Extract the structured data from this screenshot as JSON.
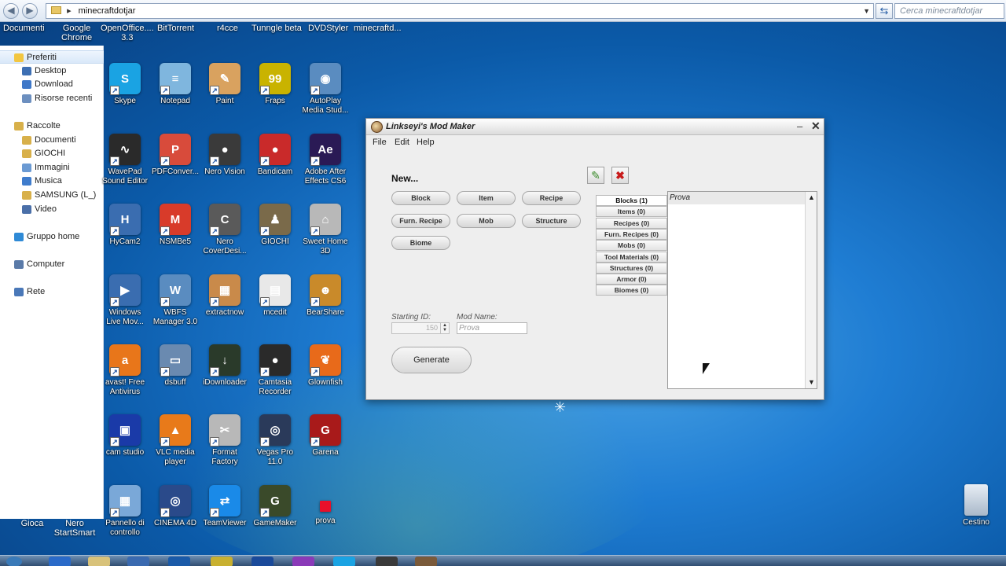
{
  "explorer": {
    "address": "minecraftdotjar",
    "search_placeholder": "Cerca minecraftdotjar",
    "favorites_bar": [
      {
        "label": "Documenti"
      },
      {
        "label": "Google\nChrome"
      },
      {
        "label": "OpenOffice....\n3.3"
      },
      {
        "label": "BitTorrent"
      },
      {
        "label": "r4cce"
      },
      {
        "label": "Tunngle beta"
      },
      {
        "label": "DVDStyler"
      },
      {
        "label": "minecraftd..."
      }
    ],
    "nav": [
      {
        "label": "Preferiti",
        "icon": "star-icon",
        "color": "#f2c641"
      },
      {
        "label": "Desktop",
        "icon": "desktop-icon",
        "color": "#3d6fb3"
      },
      {
        "label": "Download",
        "icon": "download-folder-icon",
        "color": "#3f78c8"
      },
      {
        "label": "Risorse recenti",
        "icon": "recent-places-icon",
        "color": "#6c8fbf"
      },
      {
        "label": "Raccolte",
        "icon": "libraries-icon",
        "color": "#d8b04a"
      },
      {
        "label": "Documenti",
        "icon": "documents-icon",
        "color": "#d8b04a"
      },
      {
        "label": "GIOCHI",
        "icon": "folder-icon",
        "color": "#d8b04a"
      },
      {
        "label": "Immagini",
        "icon": "pictures-icon",
        "color": "#6b9ad3"
      },
      {
        "label": "Musica",
        "icon": "music-icon",
        "color": "#3f7ccc"
      },
      {
        "label": "SAMSUNG (L_)",
        "icon": "folder-icon",
        "color": "#d8b04a"
      },
      {
        "label": "Video",
        "icon": "video-icon",
        "color": "#4a6fa8"
      },
      {
        "label": "Gruppo home",
        "icon": "homegroup-icon",
        "color": "#2f8ad6"
      },
      {
        "label": "Computer",
        "icon": "computer-icon",
        "color": "#5a7aa8"
      },
      {
        "label": "Rete",
        "icon": "network-icon",
        "color": "#4a78b8"
      }
    ],
    "bottom_items": [
      {
        "label": "Gioca"
      },
      {
        "label": "Nero\nStartSmart"
      }
    ]
  },
  "desktop": {
    "icons": [
      {
        "label": "Skype",
        "icon": "skype-icon",
        "color": "#1aa3e3",
        "glyph": "S"
      },
      {
        "label": "Notepad",
        "icon": "notepad-icon",
        "color": "#7fb6de",
        "glyph": "≡"
      },
      {
        "label": "Paint",
        "icon": "paint-icon",
        "color": "#d9a25f",
        "glyph": "✎"
      },
      {
        "label": "Fraps",
        "icon": "fraps-icon",
        "color": "#c9b300",
        "glyph": "99"
      },
      {
        "label": "AutoPlay\nMedia Stud...",
        "icon": "autoplay-icon",
        "color": "#5a8cc0",
        "glyph": "◉"
      },
      {
        "label": "WavePad\nSound Editor",
        "icon": "wavepad-icon",
        "color": "#2a2a2a",
        "glyph": "∿"
      },
      {
        "label": "PDFConver...",
        "icon": "pdf-icon",
        "color": "#d84b3b",
        "glyph": "P"
      },
      {
        "label": "Nero Vision",
        "icon": "nero-vision-icon",
        "color": "#3a3a3a",
        "glyph": "●"
      },
      {
        "label": "Bandicam",
        "icon": "bandicam-icon",
        "color": "#c92a2a",
        "glyph": "●"
      },
      {
        "label": "Adobe After\nEffects CS6",
        "icon": "after-effects-icon",
        "color": "#2a1a55",
        "glyph": "Ae"
      },
      {
        "label": "HyCam2",
        "icon": "hycam-icon",
        "color": "#3a6db0",
        "glyph": "H"
      },
      {
        "label": "NSMBe5",
        "icon": "nsmbe-icon",
        "color": "#d83b2a",
        "glyph": "M"
      },
      {
        "label": "Nero\nCoverDesi...",
        "icon": "nero-cover-icon",
        "color": "#5a5a5a",
        "glyph": "C"
      },
      {
        "label": "GIOCHI",
        "icon": "games-icon",
        "color": "#7a6a4a",
        "glyph": "♟"
      },
      {
        "label": "Sweet Home\n3D",
        "icon": "sweet-home-icon",
        "color": "#b8b8b8",
        "glyph": "⌂"
      },
      {
        "label": "Windows\nLive Mov...",
        "icon": "live-movie-icon",
        "color": "#3a6db0",
        "glyph": "▶"
      },
      {
        "label": "WBFS\nManager 3.0",
        "icon": "wbfs-icon",
        "color": "#5a8cc0",
        "glyph": "W"
      },
      {
        "label": "extractnow",
        "icon": "extractnow-icon",
        "color": "#c98a4a",
        "glyph": "▦"
      },
      {
        "label": "mcedit",
        "icon": "mcedit-icon",
        "color": "#e8e8e8",
        "glyph": "▤"
      },
      {
        "label": "BearShare",
        "icon": "bearshare-icon",
        "color": "#c98a2a",
        "glyph": "☻"
      },
      {
        "label": "avast! Free\nAntivirus",
        "icon": "avast-icon",
        "color": "#e8761a",
        "glyph": "a"
      },
      {
        "label": "dsbuff",
        "icon": "dsbuff-icon",
        "color": "#6a8ab0",
        "glyph": "▭"
      },
      {
        "label": "iDownloader",
        "icon": "idownloader-icon",
        "color": "#2a3a2a",
        "glyph": "↓"
      },
      {
        "label": "Camtasia\nRecorder",
        "icon": "camtasia-icon",
        "color": "#2a2a2a",
        "glyph": "●"
      },
      {
        "label": "Glownfish",
        "icon": "glownfish-icon",
        "color": "#e86a1a",
        "glyph": "❦"
      },
      {
        "label": "cam studio",
        "icon": "camstudio-icon",
        "color": "#1a3aa8",
        "glyph": "▣"
      },
      {
        "label": "VLC media\nplayer",
        "icon": "vlc-icon",
        "color": "#e87a1a",
        "glyph": "▲"
      },
      {
        "label": "Format\nFactory",
        "icon": "format-factory-icon",
        "color": "#b8b8b8",
        "glyph": "✂"
      },
      {
        "label": "Vegas Pro\n11.0",
        "icon": "vegas-icon",
        "color": "#2a3a5a",
        "glyph": "◎"
      },
      {
        "label": "Garena",
        "icon": "garena-icon",
        "color": "#a81a1a",
        "glyph": "G"
      },
      {
        "label": "Pannello di\ncontrollo",
        "icon": "control-panel-icon",
        "color": "#7aa8d8",
        "glyph": "▦"
      },
      {
        "label": "CINEMA 4D",
        "icon": "cinema4d-icon",
        "color": "#2a4a8a",
        "glyph": "◎"
      },
      {
        "label": "TeamViewer",
        "icon": "teamviewer-icon",
        "color": "#1a8ae8",
        "glyph": "⇄"
      },
      {
        "label": "GameMaker",
        "icon": "gamemaker-icon",
        "color": "#3a4a2a",
        "glyph": "G"
      },
      {
        "label": "prova",
        "icon": "red-square-icon",
        "color": "#e8102a",
        "glyph": ""
      }
    ],
    "recycle_bin": {
      "label": "Cestino",
      "icon": "recycle-bin-icon"
    }
  },
  "modmaker": {
    "title": "Linkseyi's Mod Maker",
    "menu": [
      "File",
      "Edit",
      "Help"
    ],
    "new_label": "New...",
    "new_buttons": [
      "Block",
      "Item",
      "Recipe",
      "Furn. Recipe",
      "Mob",
      "Structure",
      "Biome"
    ],
    "tabs": [
      "Blocks (1)",
      "Items (0)",
      "Recipes (0)",
      "Furn. Recipes (0)",
      "Mobs (0)",
      "Tool Materials (0)",
      "Structures (0)",
      "Armor (0)",
      "Biomes (0)"
    ],
    "list_items": [
      "Prova"
    ],
    "starting_id_label": "Starting ID:",
    "starting_id_value": "150",
    "mod_name_label": "Mod Name:",
    "mod_name_value": "Prova",
    "generate_label": "Generate"
  },
  "taskbar": {
    "clock": "",
    "items": [
      {
        "icon": "start-orb-icon",
        "color": "#3a7ab8"
      },
      {
        "icon": "ie-icon",
        "color": "#2a6ac8"
      },
      {
        "icon": "explorer-icon",
        "color": "#d8c27a"
      },
      {
        "icon": "media-player-icon",
        "color": "#3a6ab0"
      },
      {
        "icon": "hp-icon",
        "color": "#1a5aa8"
      },
      {
        "icon": "nero-icon",
        "color": "#c8b030"
      },
      {
        "icon": "bc-icon",
        "color": "#1a4a9a"
      },
      {
        "icon": "browser-icon",
        "color": "#8a3ab8"
      },
      {
        "icon": "skype-icon",
        "color": "#1aa3e3"
      },
      {
        "icon": "steam-icon",
        "color": "#3a3a3a"
      },
      {
        "icon": "minecraft-icon",
        "color": "#7a5a3a"
      }
    ]
  }
}
